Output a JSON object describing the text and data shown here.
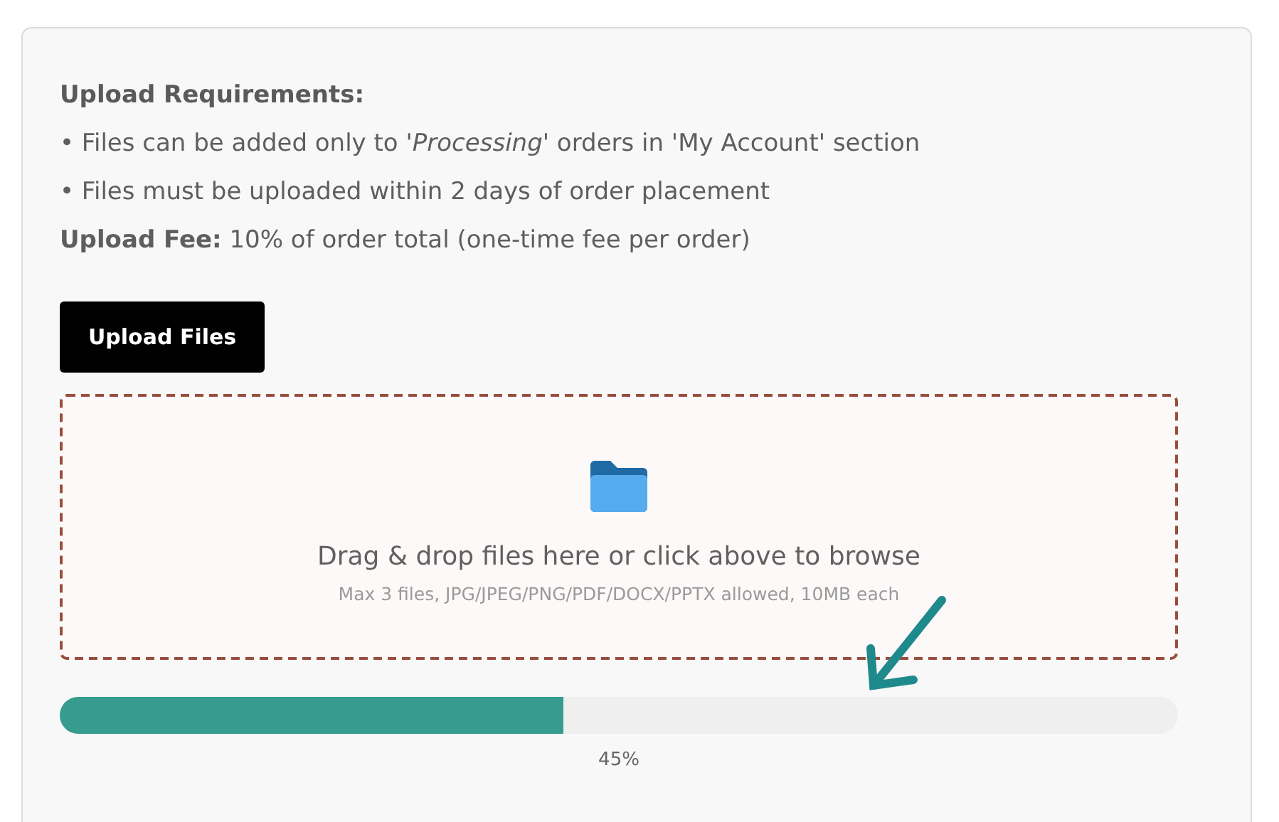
{
  "requirements": {
    "heading": "Upload Requirements:",
    "bullets": [
      "• Files can be added only to '*Processing*' orders in 'My Account' section",
      "• Files must be uploaded within 2 days of order placement"
    ],
    "fee": "**Upload Fee:** 10% of order total (one-time fee per order)"
  },
  "upload_button": "Upload Files",
  "dropzone": {
    "title": "Drag & drop files here or click above to browse",
    "hint": "Max 3 files, JPG/JPEG/PNG/PDF/DOCX/PPTX allowed, 10MB each"
  },
  "progress": {
    "level": 0.45,
    "reading": "45%"
  }
}
